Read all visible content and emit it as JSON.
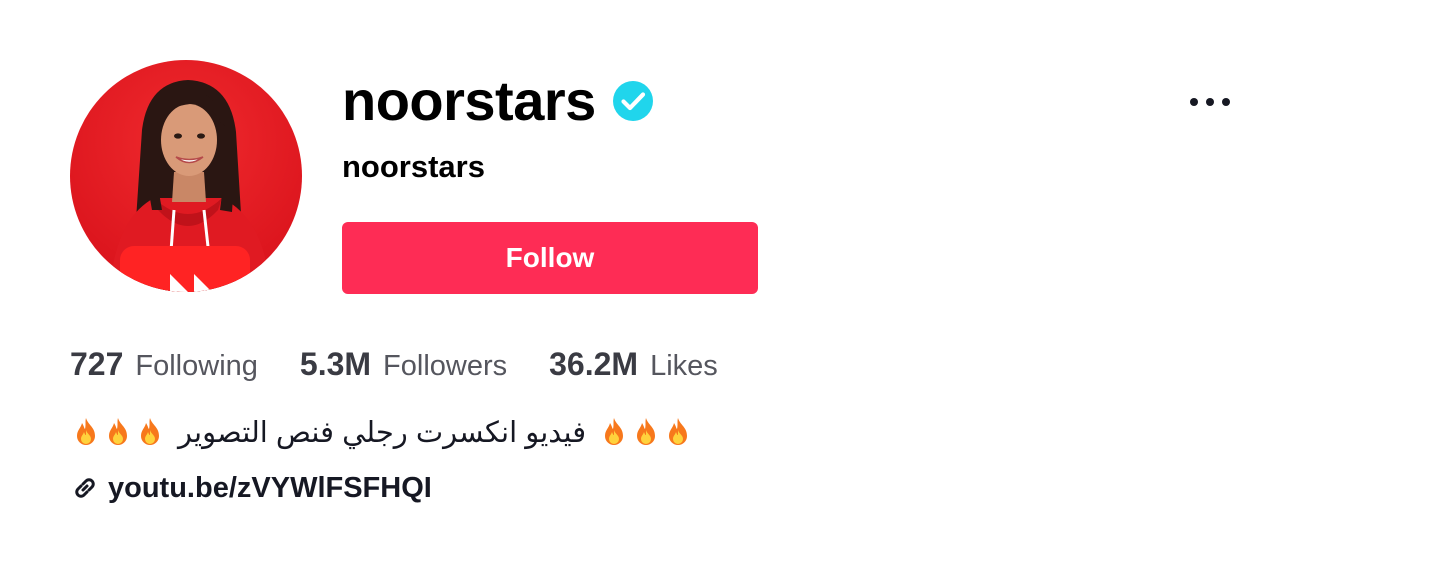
{
  "profile": {
    "title": "noorstars",
    "subtitle": "noorstars",
    "verified_icon": "verified-check-icon",
    "follow_label": "Follow",
    "more_icon": "more-options-icon"
  },
  "stats": [
    {
      "value": "727",
      "label": "Following"
    },
    {
      "value": "5.3M",
      "label": "Followers"
    },
    {
      "value": "36.2M",
      "label": "Likes"
    }
  ],
  "bio": {
    "text": "فيديو انكسرت رجلي فنص التصوير",
    "emoji_icon": "fire-emoji-icon"
  },
  "link": {
    "icon": "link-icon",
    "text": "youtu.be/zVYWlFSFHQI"
  },
  "colors": {
    "accent": "#fe2c55",
    "verified": "#20d5ec",
    "avatar_bg": "#e8151f"
  }
}
